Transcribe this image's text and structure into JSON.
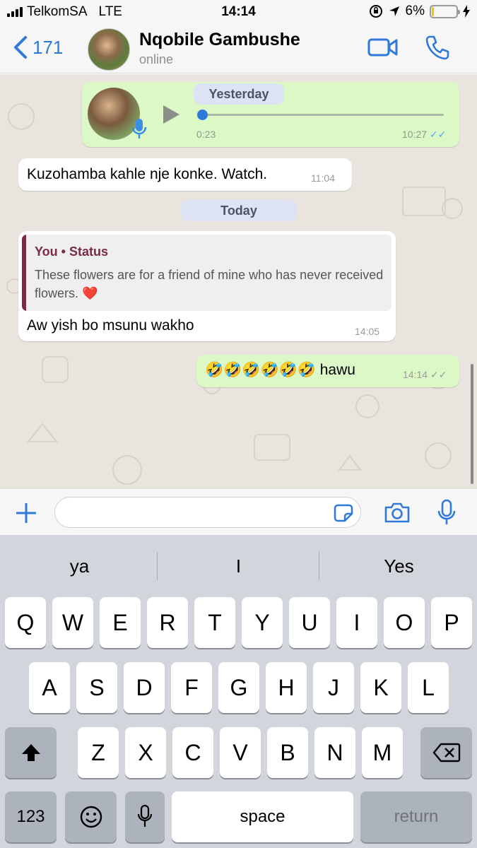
{
  "status_bar": {
    "carrier": "TelkomSA",
    "network": "LTE",
    "time": "14:14",
    "battery_percent": "6%",
    "battery_level": 0.06
  },
  "header": {
    "back_count": "171",
    "contact_name": "Nqobile Gambushe",
    "contact_status": "online"
  },
  "chat": {
    "messages": [
      {
        "type": "voice",
        "direction": "outgoing",
        "duration": "0:23",
        "time": "10:27",
        "ticks": "✓✓",
        "played_fraction": 0.0
      },
      {
        "type": "text",
        "direction": "incoming",
        "text": "Kuzohamba kahle nje konke. Watch.",
        "time": "11:04"
      },
      {
        "type": "reply",
        "direction": "incoming",
        "quote_author": "You • Status",
        "quote_text": "These flowers are for a friend of mine who has never received flowers. ❤️",
        "text": "Aw yish bo msunu wakho",
        "time": "14:05"
      },
      {
        "type": "text",
        "direction": "outgoing",
        "text": "🤣🤣🤣🤣🤣🤣 hawu",
        "time": "14:14",
        "ticks": "✓✓"
      }
    ],
    "day_separators": [
      "Yesterday",
      "Today"
    ]
  },
  "keyboard": {
    "suggestions": [
      "ya",
      "I",
      "Yes"
    ],
    "row1": [
      "Q",
      "W",
      "E",
      "R",
      "T",
      "Y",
      "U",
      "I",
      "O",
      "P"
    ],
    "row2": [
      "A",
      "S",
      "D",
      "F",
      "G",
      "H",
      "J",
      "K",
      "L"
    ],
    "row3": [
      "Z",
      "X",
      "C",
      "V",
      "B",
      "N",
      "M"
    ],
    "numbers_key": "123",
    "space_key": "space",
    "return_key": "return"
  },
  "colors": {
    "accent": "#2f7ad9",
    "outgoing_bubble": "#dcf8c6",
    "chat_bg": "#e9e4dd",
    "quote_bar": "#7b2a48"
  }
}
